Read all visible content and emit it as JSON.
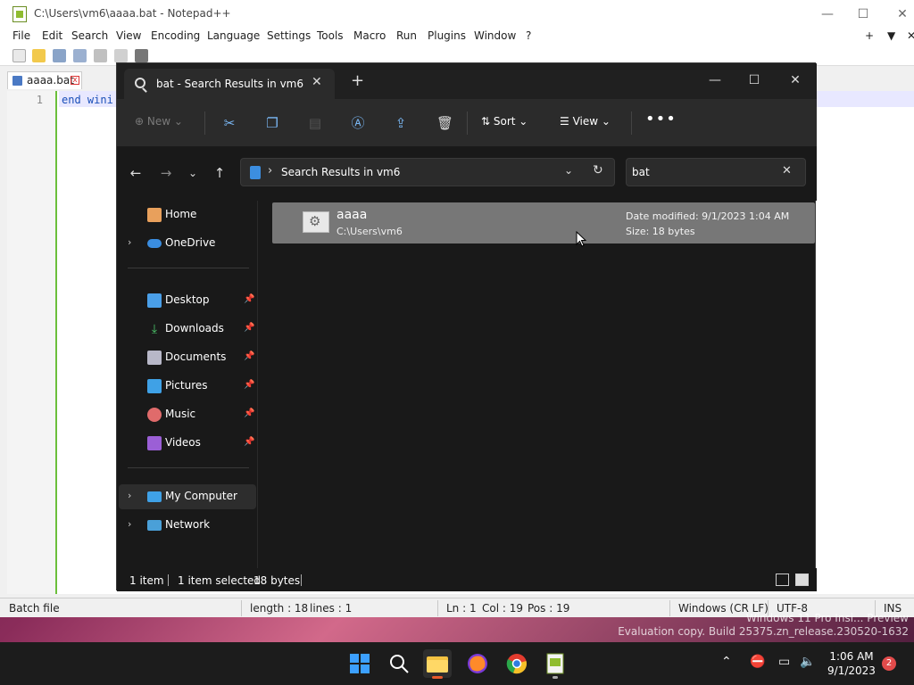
{
  "notepad": {
    "title": "C:\\Users\\vm6\\aaaa.bat - Notepad++",
    "menu": [
      "File",
      "Edit",
      "Search",
      "View",
      "Encoding",
      "Language",
      "Settings",
      "Tools",
      "Macro",
      "Run",
      "Plugins",
      "Window",
      "?"
    ],
    "menu_right": [
      "+",
      "▼",
      "✕"
    ],
    "tab_label": "aaaa.bat",
    "line_number": "1",
    "code_text": "end wini",
    "status": {
      "file_type": "Batch file",
      "length": "length : 18",
      "lines": "lines : 1",
      "ln": "Ln : 1",
      "col": "Col : 19",
      "pos": "Pos : 19",
      "eol": "Windows (CR LF)",
      "encoding": "UTF-8",
      "mode": "INS"
    }
  },
  "explorer": {
    "tab_title": "bat - Search Results in vm6",
    "commands": {
      "new": "New",
      "sort": "Sort",
      "view": "View",
      "more": "•••"
    },
    "address_path": "Search Results in vm6",
    "search_value": "bat",
    "nav": {
      "home": "Home",
      "onedrive": "OneDrive",
      "desktop": "Desktop",
      "downloads": "Downloads",
      "documents": "Documents",
      "pictures": "Pictures",
      "music": "Music",
      "videos": "Videos",
      "mycomputer": "My Computer",
      "network": "Network"
    },
    "result": {
      "name": "aaaa",
      "path": "C:\\Users\\vm6",
      "date_modified": "Date modified: 9/1/2023 1:04 AM",
      "size": "Size: 18 bytes"
    },
    "status": {
      "count": "1 item",
      "selected": "1 item selected",
      "size": "18 bytes"
    }
  },
  "watermark": {
    "line1": "Windows 11 Pro Insi... Preview",
    "line2": "Evaluation copy. Build 25375.zn_release.230520-1632"
  },
  "taskbar": {
    "time": "1:06 AM",
    "date": "9/1/2023",
    "badge": "2"
  },
  "colors": {
    "accent": "#3c8ee0",
    "selection": "#777777",
    "explorer_bg": "#191919"
  }
}
